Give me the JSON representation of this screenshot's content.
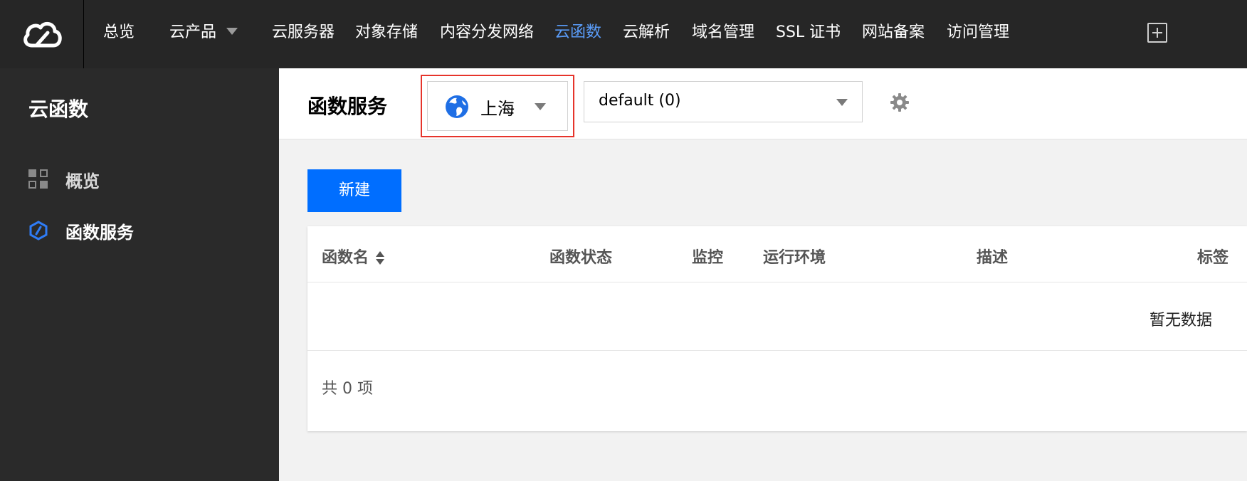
{
  "topnav": {
    "items": [
      {
        "label": "总览",
        "active": false
      },
      {
        "label": "云产品",
        "active": false,
        "dropdown": true
      },
      {
        "label": "云服务器",
        "active": false
      },
      {
        "label": "对象存储",
        "active": false
      },
      {
        "label": "内容分发网络",
        "active": false
      },
      {
        "label": "云函数",
        "active": true
      },
      {
        "label": "云解析",
        "active": false
      },
      {
        "label": "域名管理",
        "active": false
      },
      {
        "label": "SSL 证书",
        "active": false
      },
      {
        "label": "网站备案",
        "active": false
      },
      {
        "label": "访问管理",
        "active": false
      }
    ],
    "icons": [
      "cloud-logo-icon",
      "chevron-down-icon",
      "plus-square-icon"
    ]
  },
  "sidebar": {
    "title": "云函数",
    "items": [
      {
        "label": "概览",
        "icon": "grid-icon",
        "active": false
      },
      {
        "label": "函数服务",
        "icon": "function-hexagon-icon",
        "active": true
      }
    ]
  },
  "header": {
    "title": "函数服务",
    "region": "上海",
    "namespace": "default (0)",
    "icons": [
      "globe-icon",
      "gear-icon"
    ]
  },
  "main": {
    "new_button": "新建",
    "table": {
      "columns": [
        "函数名",
        "函数状态",
        "监控",
        "运行环境",
        "描述",
        "标签"
      ],
      "empty_text": "暂无数据",
      "total_text": "共 0 项"
    }
  },
  "colors": {
    "topbar": "#262626",
    "sidebar": "#2a2a2a",
    "accent": "#006eff",
    "active_nav": "#5a9cf8",
    "highlight_border": "#e6342b"
  }
}
